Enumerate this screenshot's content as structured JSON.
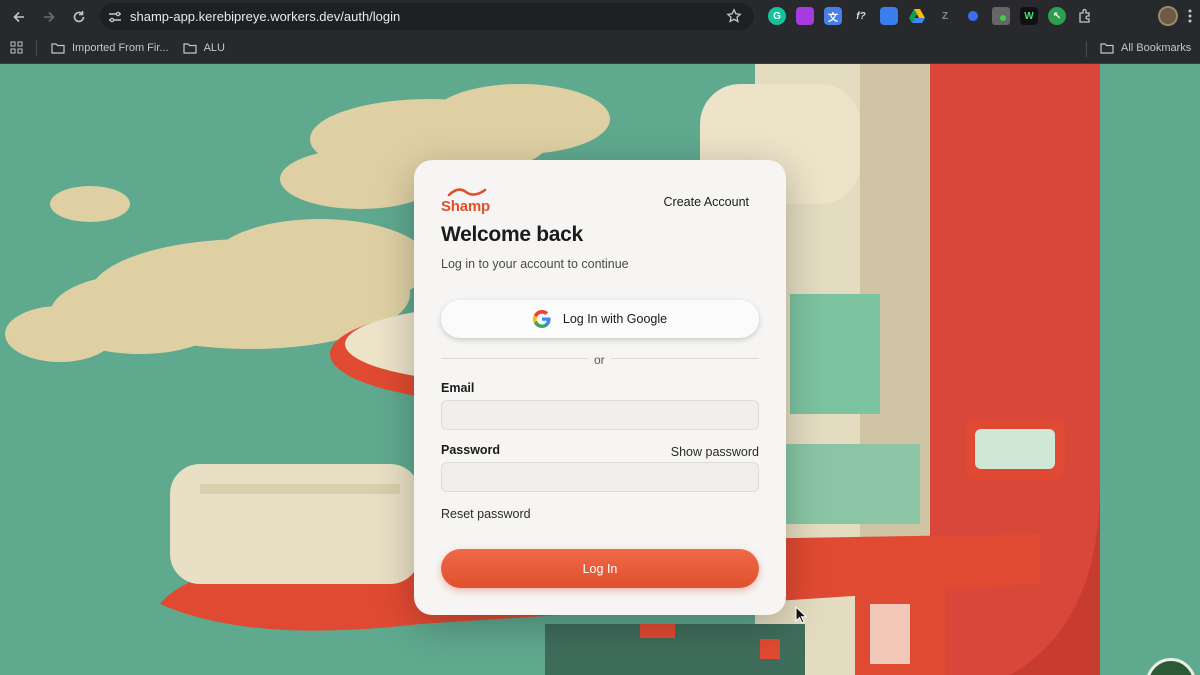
{
  "browser": {
    "url": "shamp-app.kerebipreye.workers.dev/auth/login",
    "bookmarks": [
      "Imported From Fir...",
      "ALU"
    ],
    "all_bookmarks": "All Bookmarks",
    "extensions": [
      "grammarly-icon",
      "puzzle-icon",
      "translate-icon",
      "formula-icon",
      "docs-icon",
      "drive-icon",
      "z-icon",
      "dot-icon",
      "extension-icon",
      "w-icon",
      "cursor-ext-icon",
      "extensions-icon"
    ]
  },
  "login": {
    "brand": "Shamp",
    "create_account": "Create Account",
    "title": "Welcome back",
    "subtitle": "Log in to your account to continue",
    "google_button": "Log In with Google",
    "divider_text": "or",
    "email_label": "Email",
    "email_value": "",
    "password_label": "Password",
    "show_password": "Show password",
    "password_value": "",
    "reset_password": "Reset password",
    "login_button": "Log In"
  },
  "colors": {
    "brand": "#e1502d",
    "background_sky": "#5ea98e",
    "card": "#f6f5f3"
  }
}
